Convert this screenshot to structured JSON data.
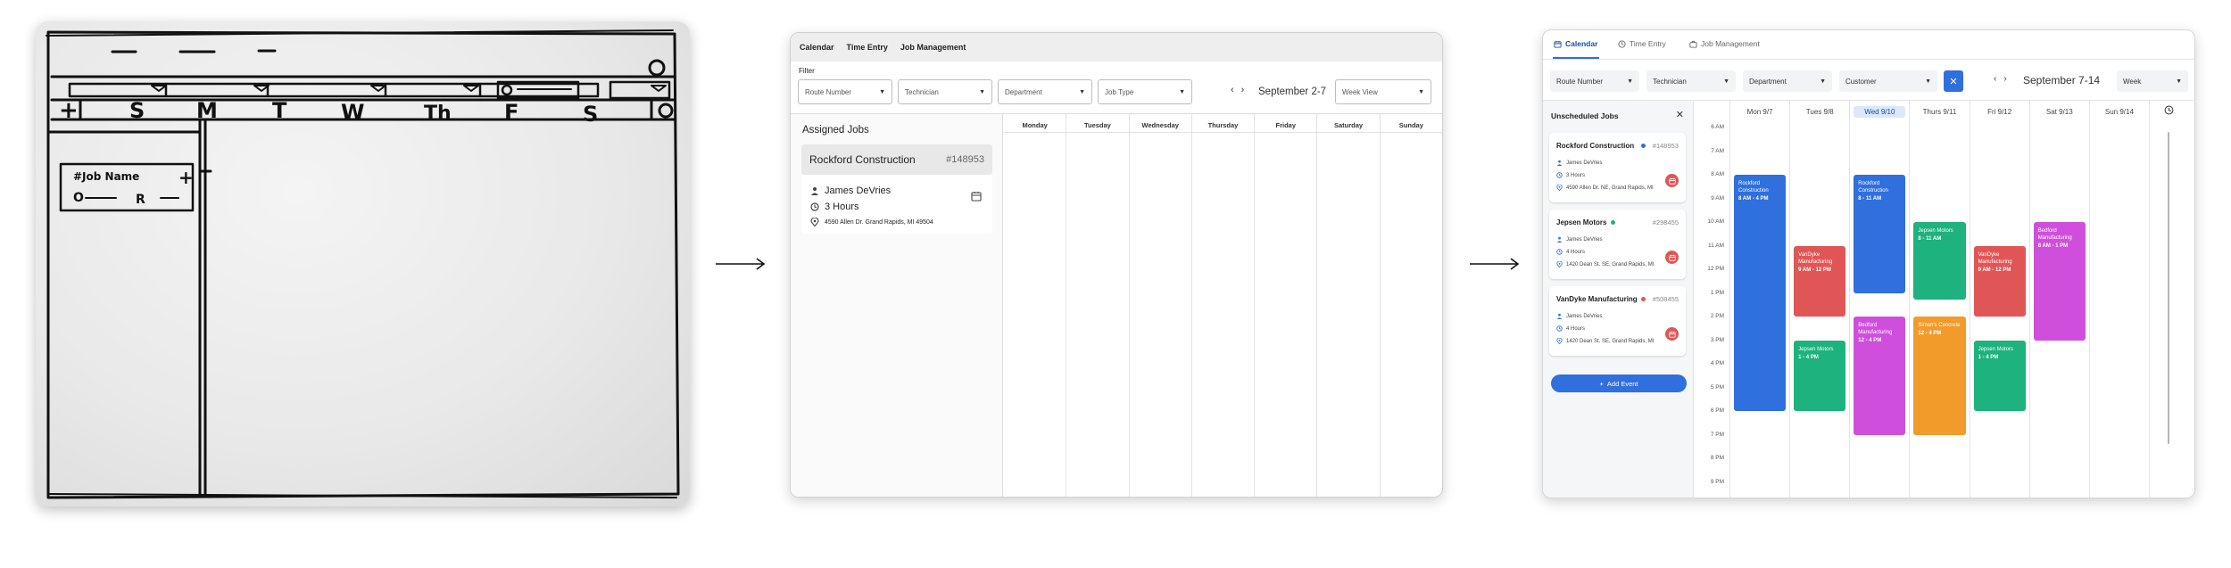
{
  "wireframe": {
    "nav": [
      "Calendar",
      "Time Entry",
      "Job Management"
    ],
    "filter_label": "Filter",
    "filters": [
      "Route Number",
      "Technician",
      "Department",
      "Job Type"
    ],
    "date_range": "September 2-7",
    "view_select": "Week View",
    "sidebar_title": "Assigned Jobs",
    "job": {
      "name": "Rockford Construction",
      "number": "#148953",
      "technician": "James DeVries",
      "duration": "3 Hours",
      "address": "4590 Allen Dr. Grand Rapids, MI 49504"
    },
    "days": [
      "Monday",
      "Tuesday",
      "Wednesday",
      "Thursday",
      "Friday",
      "Saturday",
      "Sunday"
    ]
  },
  "hifi": {
    "tabs": [
      "Calendar",
      "Time Entry",
      "Job Management"
    ],
    "filters": [
      "Route Number",
      "Technician",
      "Department",
      "Customer"
    ],
    "clear_icon": "close-icon",
    "date_range": "September 7-14",
    "view_select": "Week",
    "sidebar_title": "Unscheduled Jobs",
    "cards": [
      {
        "name": "Rockford Construction",
        "number": "#148953",
        "technician": "James DeVries",
        "duration": "3 Hours",
        "address": "4590 Allen Dr. NE, Grand Rapids, MI",
        "dot_color": "#2f6fde"
      },
      {
        "name": "Jepsen Motors",
        "number": "#298455",
        "technician": "James DeVries",
        "duration": "4 Hours",
        "address": "1420 Dean St. SE, Grand Rapids, MI",
        "dot_color": "#1db27e"
      },
      {
        "name": "VanDyke Manufacturing",
        "number": "#508455",
        "technician": "James DeVries",
        "duration": "4 Hours",
        "address": "1420 Dean St. SE, Grand Rapids, MI",
        "dot_color": "#e05656"
      }
    ],
    "add_event": "Add Event",
    "hours": [
      "6 AM",
      "7 AM",
      "8 AM",
      "9 AM",
      "10 AM",
      "11 AM",
      "12 PM",
      "1 PM",
      "2 PM",
      "3 PM",
      "4 PM",
      "5 PM",
      "6 PM",
      "7 PM",
      "8 PM",
      "9 PM"
    ],
    "days": [
      "Mon 9/7",
      "Tues 9/8",
      "Wed 9/10",
      "Thurs 9/11",
      "Fri 9/12",
      "Sat 9/13",
      "Sun 9/14"
    ],
    "today_index": 2,
    "events": [
      {
        "day": 0,
        "name": "Rockford Construction",
        "time": "8 AM - 4 PM",
        "start": 8,
        "end": 18,
        "color": "#2f6fde"
      },
      {
        "day": 1,
        "name": "VanDyke Manufacturing",
        "time": "9 AM - 12 PM",
        "start": 11,
        "end": 14,
        "color": "#e05656"
      },
      {
        "day": 1,
        "name": "Jepsen Motors",
        "time": "1 - 4 PM",
        "start": 15,
        "end": 18,
        "color": "#1db27e"
      },
      {
        "day": 2,
        "name": "Rockford Construction",
        "time": "8 - 11 AM",
        "start": 8,
        "end": 13,
        "color": "#2f6fde"
      },
      {
        "day": 2,
        "name": "Bedford Manufacturing",
        "time": "12 - 4 PM",
        "start": 14,
        "end": 19,
        "color": "#cf4fdc"
      },
      {
        "day": 3,
        "name": "Jepsen Motors",
        "time": "8 - 11 AM",
        "start": 10,
        "end": 13.3,
        "color": "#1db27e"
      },
      {
        "day": 3,
        "name": "Simon's Concrete",
        "time": "12 - 4 PM",
        "start": 14,
        "end": 19,
        "color": "#f29b2b"
      },
      {
        "day": 4,
        "name": "VanDyke Manufacturing",
        "time": "9 AM - 12 PM",
        "start": 11,
        "end": 14,
        "color": "#e05656"
      },
      {
        "day": 4,
        "name": "Jepsen Motors",
        "time": "1 - 4 PM",
        "start": 15,
        "end": 18,
        "color": "#1db27e"
      },
      {
        "day": 5,
        "name": "Bedford Manufacturing",
        "time": "8 AM - 1 PM",
        "start": 10,
        "end": 15,
        "color": "#cf4fdc"
      }
    ]
  }
}
